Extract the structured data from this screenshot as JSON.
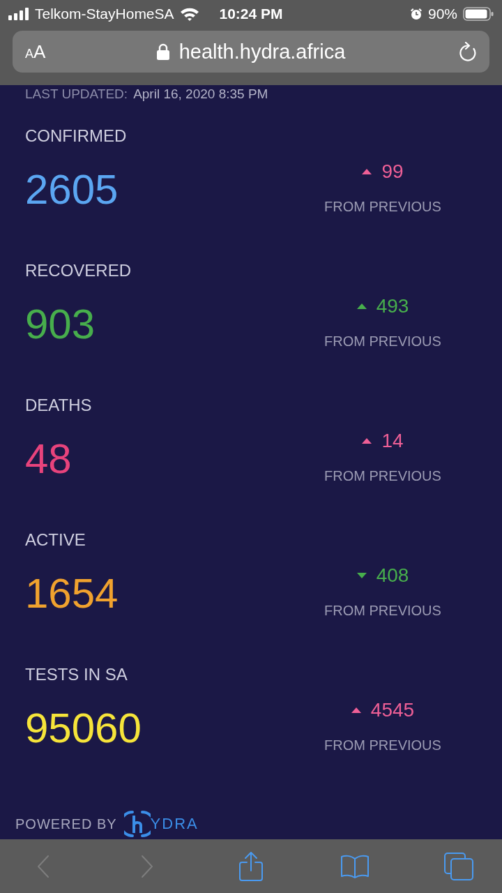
{
  "status_bar": {
    "carrier": "Telkom-StayHomeSA",
    "time": "10:24 PM",
    "battery": "90%"
  },
  "address_bar": {
    "text_size_button": [
      "A",
      "A"
    ],
    "url": "health.hydra.africa"
  },
  "last_updated": {
    "label": "LAST UPDATED:",
    "value": "April 16, 2020 8:35 PM"
  },
  "stats": [
    {
      "label": "CONFIRMED",
      "value": "2605",
      "color": "#5ba6f2",
      "change": {
        "kind": "up",
        "value": "99",
        "color": "#ef5f96"
      },
      "change_label": "FROM PREVIOUS"
    },
    {
      "label": "RECOVERED",
      "value": "903",
      "color": "#47ae4c",
      "change": {
        "kind": "up",
        "value": "493",
        "color": "#47ae4c"
      },
      "change_label": "FROM PREVIOUS"
    },
    {
      "label": "DEATHS",
      "value": "48",
      "color": "#e8437c",
      "change": {
        "kind": "up",
        "value": "14",
        "color": "#ef5f96"
      },
      "change_label": "FROM PREVIOUS"
    },
    {
      "label": "ACTIVE",
      "value": "1654",
      "color": "#f0a22e",
      "change": {
        "kind": "down",
        "value": "408",
        "color": "#47ae4c"
      },
      "change_label": "FROM PREVIOUS"
    },
    {
      "label": "TESTS IN SA",
      "value": "95060",
      "color": "#f6e43a",
      "change": {
        "kind": "up",
        "value": "4545",
        "color": "#ef5f96"
      },
      "change_label": "FROM PREVIOUS"
    }
  ],
  "footer": {
    "powered_by": "POWERED BY",
    "logo_text": "YDRA"
  },
  "toolbar": [
    {
      "kind": "back",
      "disabled": true
    },
    {
      "kind": "forward",
      "disabled": true
    },
    {
      "kind": "share",
      "disabled": false
    },
    {
      "kind": "bookmarks",
      "disabled": false
    },
    {
      "kind": "tabs",
      "disabled": false
    }
  ]
}
